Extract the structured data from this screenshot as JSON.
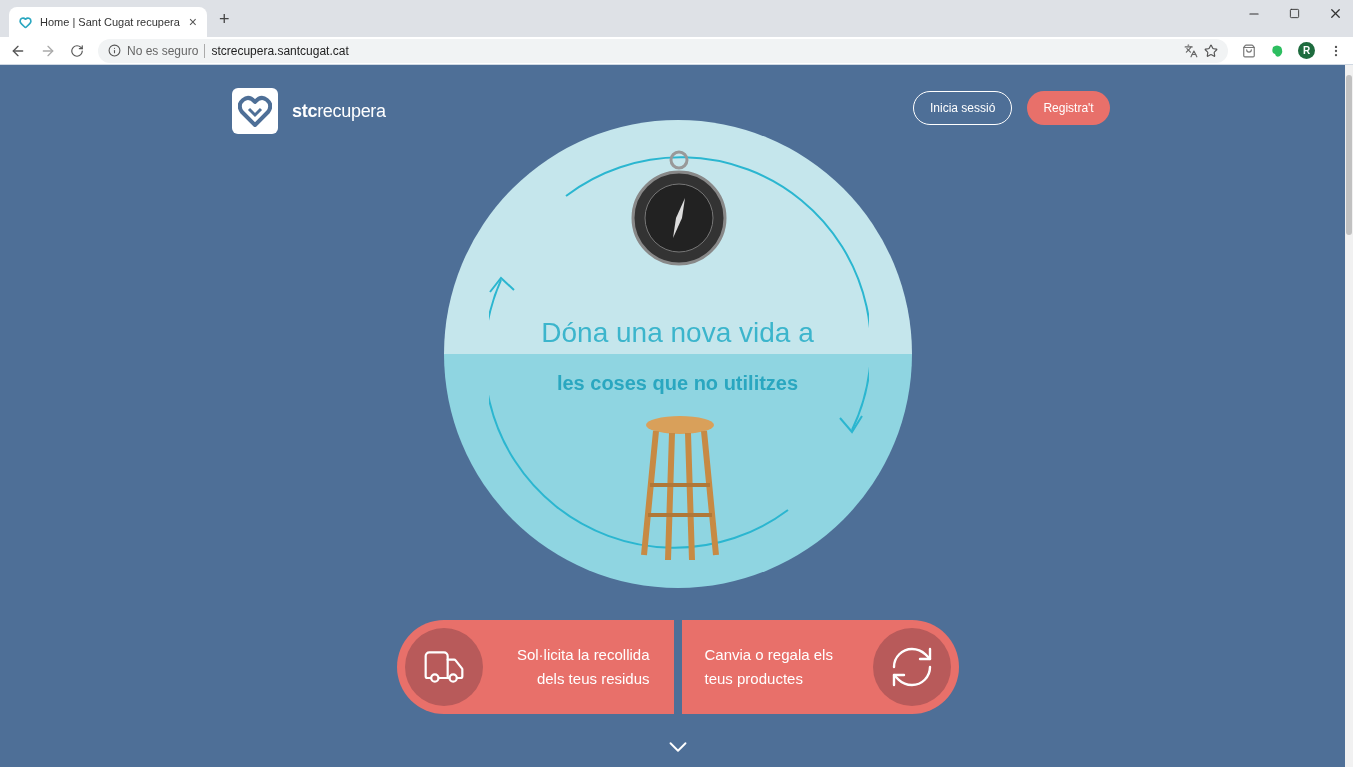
{
  "browser": {
    "tab": {
      "title": "Home | Sant Cugat recupera",
      "close": "×"
    },
    "new_tab": "+",
    "address": {
      "security": "No es seguro",
      "url": "stcrecupera.santcugat.cat"
    },
    "profile_initial": "R"
  },
  "header": {
    "logo_text": "**stc**recupera",
    "buttons": [
      {
        "label": "Inicia sessió",
        "kind": "outline"
      },
      {
        "label": "Registra't",
        "kind": "filled"
      }
    ]
  },
  "hero": {
    "title": "Dóna una nova vida a",
    "subtitle": "les coses que no utilitzes"
  },
  "actions": [
    {
      "lines": [
        "Sol·licita la recollida",
        "dels teus residus"
      ],
      "kind": "collect"
    },
    {
      "lines": [
        "Canvia o regala els",
        "teus productes"
      ],
      "kind": "exchange"
    }
  ]
}
